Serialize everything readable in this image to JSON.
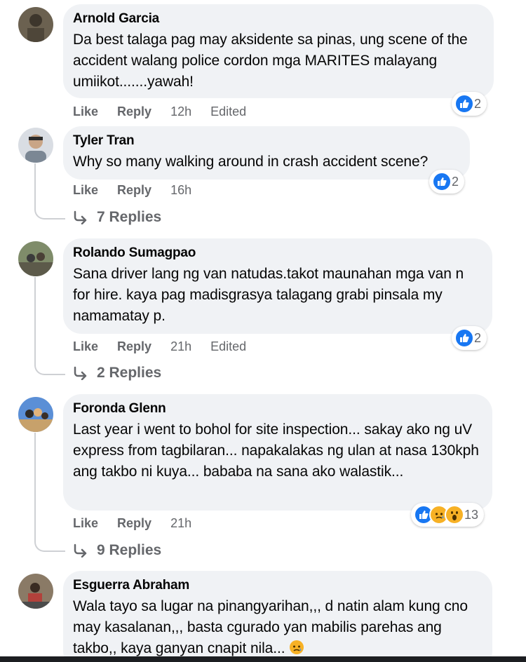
{
  "comments": [
    {
      "author": "Arnold Garcia",
      "text": "Da best talaga pag may aksidente sa pinas, ung scene of the accident walang police cordon mga MARITES malayang umiikot.......yawah!",
      "like": "Like",
      "reply": "Reply",
      "time": "12h",
      "edited": "Edited",
      "reaction_count": "2"
    },
    {
      "author": "Tyler Tran",
      "text": "Why so many walking around in crash accident scene?",
      "like": "Like",
      "reply": "Reply",
      "time": "16h",
      "reaction_count": "2",
      "replies": "7 Replies"
    },
    {
      "author": "Rolando Sumagpao",
      "text": "Sana driver lang ng van natudas.takot maunahan mga van n for hire. kaya pag madisgrasya talagang grabi pinsala my namamatay p.",
      "like": "Like",
      "reply": "Reply",
      "time": "21h",
      "edited": "Edited",
      "reaction_count": "2",
      "replies": "2 Replies"
    },
    {
      "author": "Foronda Glenn",
      "text": "Last year i went to bohol for site inspection... sakay ako ng uV express from tagbilaran... napakalakas ng ulan at nasa 130kph ang takbo ni kuya... bababa na sana ako walastik...",
      "like": "Like",
      "reply": "Reply",
      "time": "21h",
      "reaction_count": "13",
      "replies": "9 Replies"
    },
    {
      "author": "Esguerra Abraham",
      "text": "Wala tayo sa lugar na pinangyarihan,,, d natin alam kung cno may kasalanan,,, basta cgurado yan mabilis parehas ang takbo,, kaya ganyan cnapit nila..."
    }
  ],
  "colors": {
    "bubble": "#f0f2f5",
    "like_blue": "#1877f2",
    "meta_gray": "#65676b",
    "thread_line": "#ced0d4"
  }
}
